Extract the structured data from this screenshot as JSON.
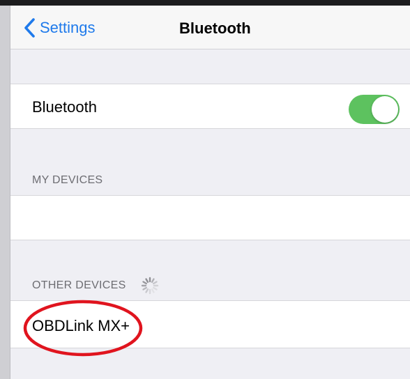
{
  "nav": {
    "back_label": "Settings",
    "title": "Bluetooth"
  },
  "bluetooth_row": {
    "label": "Bluetooth",
    "toggle_on": true
  },
  "sections": {
    "my_devices_header": "MY DEVICES",
    "other_devices_header": "OTHER DEVICES"
  },
  "other_devices": [
    {
      "name": "OBDLink MX+"
    }
  ],
  "colors": {
    "accent": "#1f7aeb",
    "toggle_on": "#5dc25f",
    "annotation": "#e0141e"
  }
}
